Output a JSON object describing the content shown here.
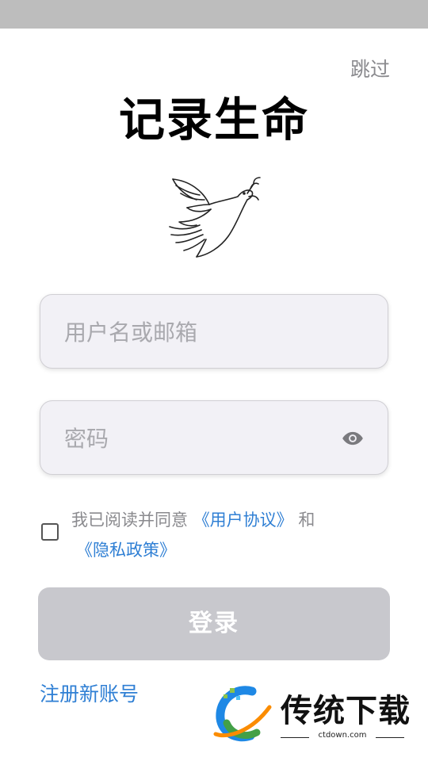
{
  "skip_label": "跳过",
  "title": "记录生命",
  "username_field": {
    "placeholder": "用户名或邮箱",
    "value": ""
  },
  "password_field": {
    "placeholder": "密码",
    "value": ""
  },
  "agreement": {
    "checked": false,
    "prefix": "我已阅读并同意 ",
    "user_agreement_link": "《用户协议》",
    "conjunction": " 和",
    "privacy_policy_link": "《隐私政策》"
  },
  "login_label": "登录",
  "register_label": "注册新账号",
  "watermark": {
    "brand": "传统下载",
    "url": "ctdown.com"
  },
  "colors": {
    "link": "#2f7fd4",
    "button_disabled": "#c8c8cd",
    "field_bg": "#f2f1f6"
  },
  "icons": {
    "visibility": "eye-icon",
    "logo": "dove-icon"
  }
}
